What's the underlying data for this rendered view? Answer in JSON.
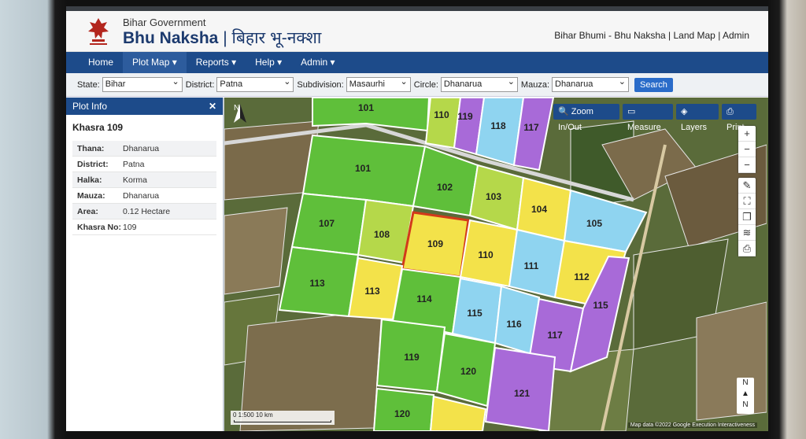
{
  "header": {
    "gov": "Bihar Government",
    "brand_en": "Bhu Naksha",
    "brand_sep": " | ",
    "brand_hi": "बिहार भू-नक्शा",
    "links": "Bihar Bhumi - Bhu Naksha | Land Map  |  Admin"
  },
  "nav": {
    "home": "Home",
    "plot_map": "Plot Map ▾",
    "reports": "Reports ▾",
    "help": "Help ▾",
    "admin": "Admin ▾"
  },
  "filters": {
    "state_label": "State:",
    "state_value": "Bihar",
    "district_label": "District:",
    "district_value": "Patna",
    "subdivision_label": "Subdivision:",
    "subdivision_value": "Masaurhi",
    "circle_label": "Circle:",
    "circle_value": "Dhanarua",
    "mauza_label": "Mauza:",
    "mauza_value": "Dhanarua",
    "search": "Search"
  },
  "panel": {
    "title": "Plot Info",
    "close": "✕",
    "khasra_title": "Khasra 109",
    "rows": [
      {
        "k": "Thana:",
        "v": "Dhanarua"
      },
      {
        "k": "District:",
        "v": "Patna"
      },
      {
        "k": "Halka:",
        "v": "Korma"
      },
      {
        "k": "Mauza:",
        "v": "Dhanarua"
      },
      {
        "k": "Area:",
        "v": "0.12 Hectare"
      },
      {
        "k": "Khasra No:",
        "v": "109"
      }
    ]
  },
  "map": {
    "tools": {
      "zoom": "Zoom In/Out",
      "measure": "Measure",
      "layers": "Layers",
      "print": "Print"
    },
    "north": "N",
    "compass_n": "N",
    "scale_text": "0     1:500      10 km",
    "attribution": "Map data ©2022 Google  Execution  Interactiveness",
    "colors": {
      "green": "#5fbf3a",
      "lime": "#b5d84a",
      "yellow": "#f3e24a",
      "blue": "#8fd4f0",
      "purple": "#a86ad8",
      "selected_border": "#d23a1a"
    },
    "plots": [
      "101",
      "110",
      "119",
      "118",
      "117",
      "101",
      "102",
      "103",
      "104",
      "105",
      "107",
      "108",
      "109",
      "110",
      "111",
      "112",
      "113",
      "113",
      "114",
      "115",
      "116",
      "117",
      "115",
      "119",
      "120",
      "121",
      "120"
    ]
  }
}
